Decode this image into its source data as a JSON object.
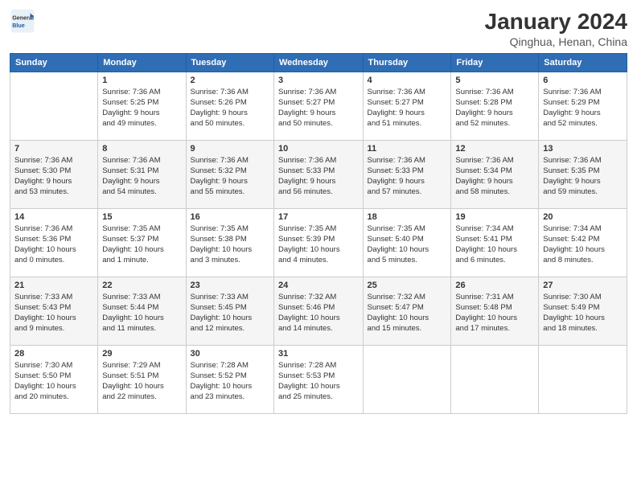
{
  "header": {
    "logo_general": "General",
    "logo_blue": "Blue",
    "main_title": "January 2024",
    "subtitle": "Qinghua, Henan, China"
  },
  "days_of_week": [
    "Sunday",
    "Monday",
    "Tuesday",
    "Wednesday",
    "Thursday",
    "Friday",
    "Saturday"
  ],
  "weeks": [
    [
      {
        "num": "",
        "info": ""
      },
      {
        "num": "1",
        "info": "Sunrise: 7:36 AM\nSunset: 5:25 PM\nDaylight: 9 hours\nand 49 minutes."
      },
      {
        "num": "2",
        "info": "Sunrise: 7:36 AM\nSunset: 5:26 PM\nDaylight: 9 hours\nand 50 minutes."
      },
      {
        "num": "3",
        "info": "Sunrise: 7:36 AM\nSunset: 5:27 PM\nDaylight: 9 hours\nand 50 minutes."
      },
      {
        "num": "4",
        "info": "Sunrise: 7:36 AM\nSunset: 5:27 PM\nDaylight: 9 hours\nand 51 minutes."
      },
      {
        "num": "5",
        "info": "Sunrise: 7:36 AM\nSunset: 5:28 PM\nDaylight: 9 hours\nand 52 minutes."
      },
      {
        "num": "6",
        "info": "Sunrise: 7:36 AM\nSunset: 5:29 PM\nDaylight: 9 hours\nand 52 minutes."
      }
    ],
    [
      {
        "num": "7",
        "info": "Sunrise: 7:36 AM\nSunset: 5:30 PM\nDaylight: 9 hours\nand 53 minutes."
      },
      {
        "num": "8",
        "info": "Sunrise: 7:36 AM\nSunset: 5:31 PM\nDaylight: 9 hours\nand 54 minutes."
      },
      {
        "num": "9",
        "info": "Sunrise: 7:36 AM\nSunset: 5:32 PM\nDaylight: 9 hours\nand 55 minutes."
      },
      {
        "num": "10",
        "info": "Sunrise: 7:36 AM\nSunset: 5:33 PM\nDaylight: 9 hours\nand 56 minutes."
      },
      {
        "num": "11",
        "info": "Sunrise: 7:36 AM\nSunset: 5:33 PM\nDaylight: 9 hours\nand 57 minutes."
      },
      {
        "num": "12",
        "info": "Sunrise: 7:36 AM\nSunset: 5:34 PM\nDaylight: 9 hours\nand 58 minutes."
      },
      {
        "num": "13",
        "info": "Sunrise: 7:36 AM\nSunset: 5:35 PM\nDaylight: 9 hours\nand 59 minutes."
      }
    ],
    [
      {
        "num": "14",
        "info": "Sunrise: 7:36 AM\nSunset: 5:36 PM\nDaylight: 10 hours\nand 0 minutes."
      },
      {
        "num": "15",
        "info": "Sunrise: 7:35 AM\nSunset: 5:37 PM\nDaylight: 10 hours\nand 1 minute."
      },
      {
        "num": "16",
        "info": "Sunrise: 7:35 AM\nSunset: 5:38 PM\nDaylight: 10 hours\nand 3 minutes."
      },
      {
        "num": "17",
        "info": "Sunrise: 7:35 AM\nSunset: 5:39 PM\nDaylight: 10 hours\nand 4 minutes."
      },
      {
        "num": "18",
        "info": "Sunrise: 7:35 AM\nSunset: 5:40 PM\nDaylight: 10 hours\nand 5 minutes."
      },
      {
        "num": "19",
        "info": "Sunrise: 7:34 AM\nSunset: 5:41 PM\nDaylight: 10 hours\nand 6 minutes."
      },
      {
        "num": "20",
        "info": "Sunrise: 7:34 AM\nSunset: 5:42 PM\nDaylight: 10 hours\nand 8 minutes."
      }
    ],
    [
      {
        "num": "21",
        "info": "Sunrise: 7:33 AM\nSunset: 5:43 PM\nDaylight: 10 hours\nand 9 minutes."
      },
      {
        "num": "22",
        "info": "Sunrise: 7:33 AM\nSunset: 5:44 PM\nDaylight: 10 hours\nand 11 minutes."
      },
      {
        "num": "23",
        "info": "Sunrise: 7:33 AM\nSunset: 5:45 PM\nDaylight: 10 hours\nand 12 minutes."
      },
      {
        "num": "24",
        "info": "Sunrise: 7:32 AM\nSunset: 5:46 PM\nDaylight: 10 hours\nand 14 minutes."
      },
      {
        "num": "25",
        "info": "Sunrise: 7:32 AM\nSunset: 5:47 PM\nDaylight: 10 hours\nand 15 minutes."
      },
      {
        "num": "26",
        "info": "Sunrise: 7:31 AM\nSunset: 5:48 PM\nDaylight: 10 hours\nand 17 minutes."
      },
      {
        "num": "27",
        "info": "Sunrise: 7:30 AM\nSunset: 5:49 PM\nDaylight: 10 hours\nand 18 minutes."
      }
    ],
    [
      {
        "num": "28",
        "info": "Sunrise: 7:30 AM\nSunset: 5:50 PM\nDaylight: 10 hours\nand 20 minutes."
      },
      {
        "num": "29",
        "info": "Sunrise: 7:29 AM\nSunset: 5:51 PM\nDaylight: 10 hours\nand 22 minutes."
      },
      {
        "num": "30",
        "info": "Sunrise: 7:28 AM\nSunset: 5:52 PM\nDaylight: 10 hours\nand 23 minutes."
      },
      {
        "num": "31",
        "info": "Sunrise: 7:28 AM\nSunset: 5:53 PM\nDaylight: 10 hours\nand 25 minutes."
      },
      {
        "num": "",
        "info": ""
      },
      {
        "num": "",
        "info": ""
      },
      {
        "num": "",
        "info": ""
      }
    ]
  ]
}
